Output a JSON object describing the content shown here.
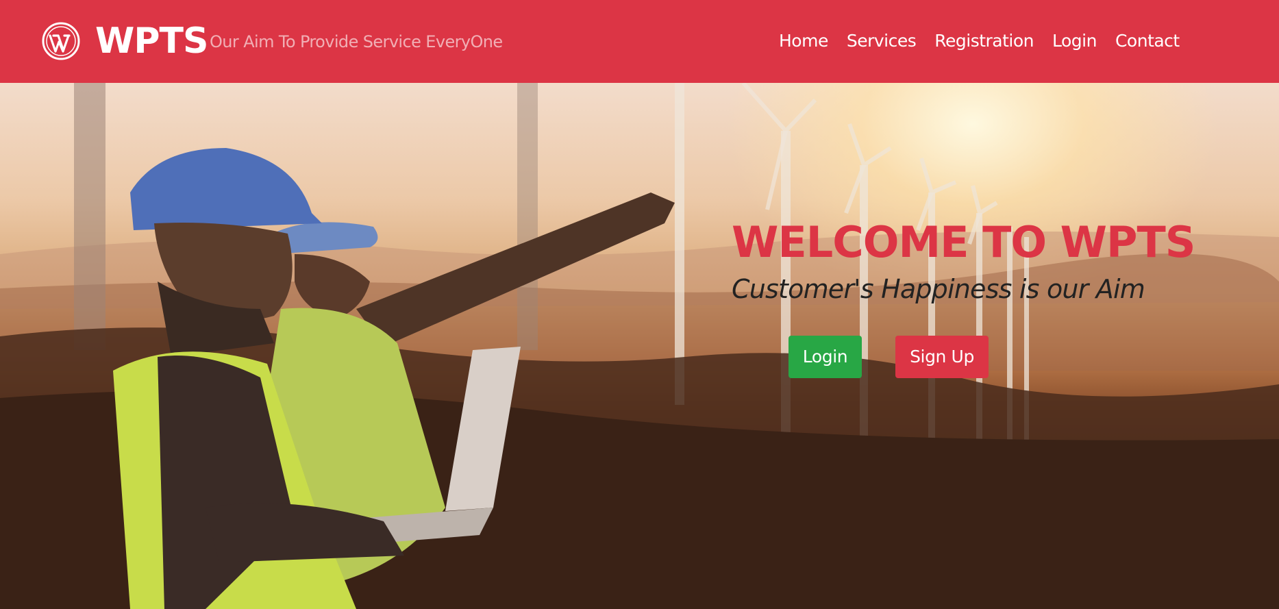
{
  "header": {
    "brand_name": "WPTS",
    "tagline": "Our Aim To Provide Service EveryOne",
    "logo_icon": "wordpress-icon",
    "nav": [
      {
        "label": "Home"
      },
      {
        "label": "Services"
      },
      {
        "label": "Registration"
      },
      {
        "label": "Login"
      },
      {
        "label": "Contact"
      }
    ]
  },
  "hero": {
    "title": "WELCOME TO WPTS",
    "subtitle": "Customer's Happiness is our Aim",
    "login_button": "Login",
    "signup_button": "Sign Up"
  },
  "colors": {
    "brand": "#dc3545",
    "success": "#28a745",
    "text_dark": "#222222"
  }
}
